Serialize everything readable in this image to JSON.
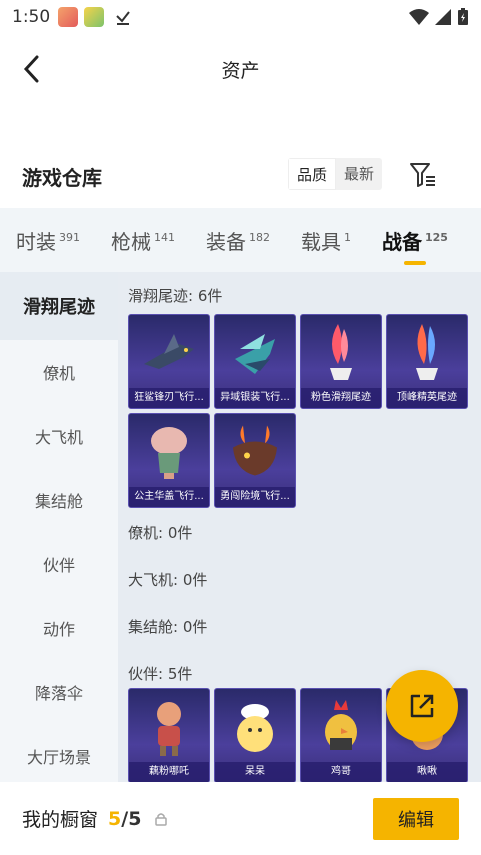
{
  "status_bar": {
    "time": "1:50"
  },
  "header": {
    "title": "资产"
  },
  "warehouse": {
    "title": "游戏仓库",
    "sort_options": [
      "品质",
      "最新"
    ],
    "active_sort": "品质"
  },
  "tabs": [
    {
      "label": "时装",
      "count": "391"
    },
    {
      "label": "枪械",
      "count": "141"
    },
    {
      "label": "装备",
      "count": "182"
    },
    {
      "label": "载具",
      "count": "1"
    },
    {
      "label": "战备",
      "count": "125"
    }
  ],
  "active_tab": "战备",
  "sidebar": {
    "items": [
      "滑翔尾迹",
      "僚机",
      "大飞机",
      "集结舱",
      "伙伴",
      "动作",
      "降落伞",
      "大厅场景"
    ],
    "active": "滑翔尾迹"
  },
  "sections": [
    {
      "header": "滑翔尾迹: 6件",
      "items": [
        "狂鲨锋刃飞行...",
        "异域银装飞行...",
        "粉色滑翔尾迹",
        "顶峰精英尾迹",
        "公主华盖飞行...",
        "勇闯险境飞行..."
      ]
    },
    {
      "header": "僚机: 0件",
      "items": []
    },
    {
      "header": "大飞机: 0件",
      "items": []
    },
    {
      "header": "集结舱: 0件",
      "items": []
    },
    {
      "header": "伙伴: 5件",
      "items": [
        "藕粉哪吒",
        "呆呆",
        "鸡哥",
        "啾啾"
      ]
    }
  ],
  "showcase": {
    "label": "我的橱窗",
    "current": "5",
    "total": "5",
    "edit_label": "编辑"
  },
  "colors": {
    "accent": "#f5b400",
    "card_bg": "#3c3284",
    "content_bg": "#e7ecf2"
  },
  "icons": [
    "back-arrow-icon",
    "filter-icon",
    "share-icon",
    "lock-icon",
    "download-icon",
    "wifi-icon",
    "signal-icon",
    "battery-icon"
  ]
}
